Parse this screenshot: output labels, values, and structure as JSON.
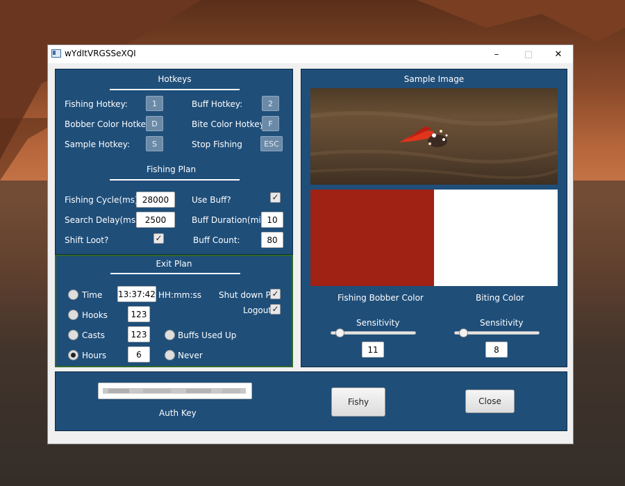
{
  "window": {
    "title": "wYdItVRGSSeXQI",
    "minimize_glyph": "–",
    "maximize_glyph": "□",
    "close_glyph": "✕"
  },
  "hotkeys": {
    "header": "Hotkeys",
    "fishing_label": "Fishing Hotkey:",
    "fishing_value": "1",
    "buff_label": "Buff Hotkey:",
    "buff_value": "2",
    "bobber_color_label": "Bobber Color Hotkey:",
    "bobber_color_value": "D",
    "bite_color_label": "Bite Color Hotkey:",
    "bite_color_value": "F",
    "sample_label": "Sample Hotkey:",
    "sample_value": "S",
    "stop_label": "Stop Fishing",
    "stop_value": "ESC"
  },
  "fishing_plan": {
    "header": "Fishing Plan",
    "cycle_label": "Fishing Cycle(ms):",
    "cycle_value": "28000",
    "use_buff_label": "Use Buff?",
    "use_buff_checked": true,
    "search_delay_label": "Search Delay(ms):",
    "search_delay_value": "2500",
    "buff_duration_label": "Buff Duration(min):",
    "buff_duration_value": "10",
    "shift_loot_label": "Shift Loot?",
    "shift_loot_checked": true,
    "buff_count_label": "Buff Count:",
    "buff_count_value": "80"
  },
  "exit_plan": {
    "header": "Exit Plan",
    "time_label": "Time",
    "time_value": "13:37:42",
    "time_format": "HH:mm:ss",
    "shutdown_label": "Shut down PC",
    "shutdown_checked": true,
    "logout_label": "Logout",
    "logout_checked": true,
    "hooks_label": "Hooks",
    "hooks_value": "123",
    "casts_label": "Casts",
    "casts_value": "123",
    "buffs_used_up_label": "Buffs Used Up",
    "hours_label": "Hours",
    "hours_value": "6",
    "never_label": "Never",
    "selected": "Hours",
    "check_glyph": "✓"
  },
  "sample": {
    "header": "Sample Image",
    "bobber_color": "#a02214",
    "biting_color": "#ffffff",
    "bobber_color_label": "Fishing Bobber Color",
    "biting_color_label": "Biting Color",
    "sensitivity_label_left": "Sensitivity",
    "sensitivity_label_right": "Sensitivity",
    "sensitivity_left_value": "11",
    "sensitivity_right_value": "8",
    "sensitivity_left_fraction": 0.06,
    "sensitivity_right_fraction": 0.06
  },
  "footer": {
    "auth_key_label": "Auth Key",
    "auth_key_value": "",
    "fishy_button": "Fishy",
    "close_button": "Close"
  }
}
